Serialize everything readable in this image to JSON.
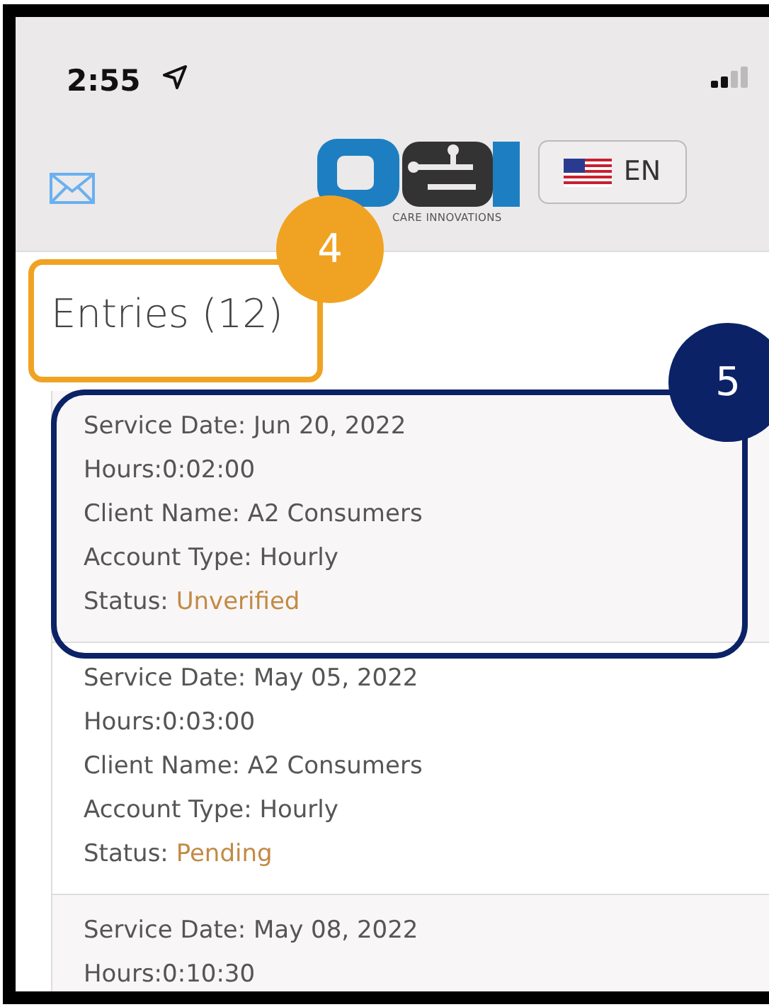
{
  "status_bar": {
    "time": "2:55"
  },
  "header": {
    "logo": {
      "tagline": "CARE INNOVATIONS"
    },
    "language_button": {
      "label": "EN"
    }
  },
  "heading": "Entries (12)",
  "entries": [
    {
      "lines": [
        "Service Date: Jun 20, 2022",
        "Hours:0:02:00",
        "Client Name: A2 Consumers",
        "Account Type: Hourly"
      ],
      "status_label": "Status:",
      "status": "Unverified"
    },
    {
      "lines": [
        "Service Date: May 05, 2022",
        "Hours:0:03:00",
        "Client Name: A2 Consumers",
        "Account Type: Hourly"
      ],
      "status_label": "Status:",
      "status": "Pending"
    },
    {
      "lines": [
        "Service Date: May 08, 2022",
        "Hours:0:10:30"
      ]
    }
  ],
  "callouts": [
    {
      "number": "4"
    },
    {
      "number": "5"
    }
  ]
}
